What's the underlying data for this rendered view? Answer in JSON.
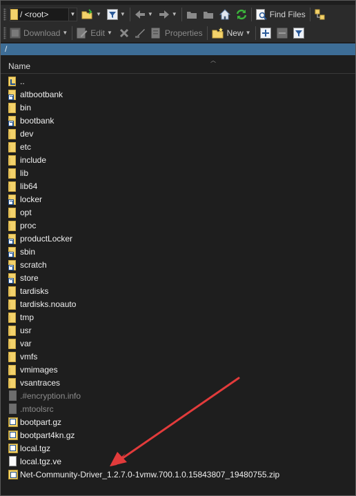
{
  "toolbar1": {
    "location": "/ <root>",
    "find_files": "Find Files"
  },
  "toolbar2": {
    "download": "Download",
    "edit": "Edit",
    "properties": "Properties",
    "new": "New"
  },
  "path": "/",
  "columns": {
    "name": "Name"
  },
  "files": [
    {
      "name": "..",
      "type": "up"
    },
    {
      "name": "altbootbank",
      "type": "folder-link"
    },
    {
      "name": "bin",
      "type": "folder"
    },
    {
      "name": "bootbank",
      "type": "folder-link"
    },
    {
      "name": "dev",
      "type": "folder"
    },
    {
      "name": "etc",
      "type": "folder"
    },
    {
      "name": "include",
      "type": "folder"
    },
    {
      "name": "lib",
      "type": "folder"
    },
    {
      "name": "lib64",
      "type": "folder"
    },
    {
      "name": "locker",
      "type": "folder-link"
    },
    {
      "name": "opt",
      "type": "folder"
    },
    {
      "name": "proc",
      "type": "folder"
    },
    {
      "name": "productLocker",
      "type": "folder-link"
    },
    {
      "name": "sbin",
      "type": "folder-link"
    },
    {
      "name": "scratch",
      "type": "folder-link"
    },
    {
      "name": "store",
      "type": "folder-link"
    },
    {
      "name": "tardisks",
      "type": "folder"
    },
    {
      "name": "tardisks.noauto",
      "type": "folder"
    },
    {
      "name": "tmp",
      "type": "folder"
    },
    {
      "name": "usr",
      "type": "folder"
    },
    {
      "name": "var",
      "type": "folder"
    },
    {
      "name": "vmfs",
      "type": "folder"
    },
    {
      "name": "vmimages",
      "type": "folder"
    },
    {
      "name": "vsantraces",
      "type": "folder"
    },
    {
      "name": ".#encryption.info",
      "type": "hidden-file"
    },
    {
      "name": ".mtoolsrc",
      "type": "hidden-file"
    },
    {
      "name": "bootpart.gz",
      "type": "archive"
    },
    {
      "name": "bootpart4kn.gz",
      "type": "archive"
    },
    {
      "name": "local.tgz",
      "type": "archive"
    },
    {
      "name": "local.tgz.ve",
      "type": "file"
    },
    {
      "name": "Net-Community-Driver_1.2.7.0-1vmw.700.1.0.15843807_19480755.zip",
      "type": "zip"
    }
  ],
  "colors": {
    "path_bar": "#3d6d96",
    "annotation_arrow": "#e23b3b",
    "folder": "#f3d26b"
  }
}
